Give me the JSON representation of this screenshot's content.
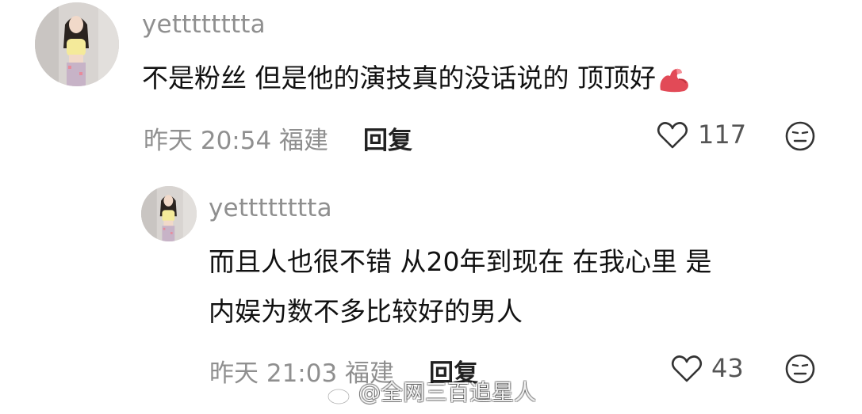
{
  "comments": [
    {
      "username": "yetttttttta",
      "text": "不是粉丝 但是他的演技真的没话说的 顶顶好",
      "emoji": "flexed-biceps",
      "time": "昨天 20:54 福建",
      "reply_label": "回复",
      "likes": "117"
    },
    {
      "username": "yetttttttta",
      "text_line1": "而且人也很不错 从20年到现在 在我心里 是",
      "text_line2": "内娱为数不多比较好的男人",
      "time": "昨天 21:03 福建",
      "reply_label": "回复",
      "likes": "43"
    }
  ],
  "watermark": {
    "text": "@全网三百追星人",
    "icon": "weibo-logo"
  },
  "colors": {
    "username": "#8f8f8f",
    "text": "#111111",
    "meta": "#8f8f8f",
    "background": "#ffffff"
  }
}
